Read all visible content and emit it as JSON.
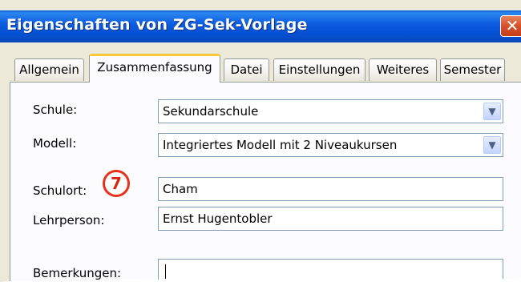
{
  "window": {
    "title": "Eigenschaften von ZG-Sek-Vorlage",
    "close_symbol": "✕"
  },
  "tabs": [
    {
      "label": "Allgemein",
      "active": false
    },
    {
      "label": "Zusammenfassung",
      "active": true
    },
    {
      "label": "Datei",
      "active": false
    },
    {
      "label": "Einstellungen",
      "active": false
    },
    {
      "label": "Weiteres",
      "active": false
    },
    {
      "label": "Semester",
      "active": false
    }
  ],
  "form": {
    "schule": {
      "label": "Schule:",
      "value": "Sekundarschule"
    },
    "modell": {
      "label": "Modell:",
      "value": "Integriertes Modell mit 2 Niveaukursen"
    },
    "schulort": {
      "label": "Schulort:",
      "value": "Cham"
    },
    "lehrperson": {
      "label": "Lehrperson:",
      "value": "Ernst Hugentobler"
    },
    "bemerkungen": {
      "label": "Bemerkungen:",
      "value": ""
    }
  },
  "annotation": {
    "number": "7",
    "color": "#e8301a"
  },
  "icons": {
    "dropdown": "chevron-down-icon",
    "close": "close-icon"
  },
  "colors": {
    "titlebar": "#0552d6",
    "active_tab_accent": "#ffc83c",
    "background": "#ece9d8"
  }
}
